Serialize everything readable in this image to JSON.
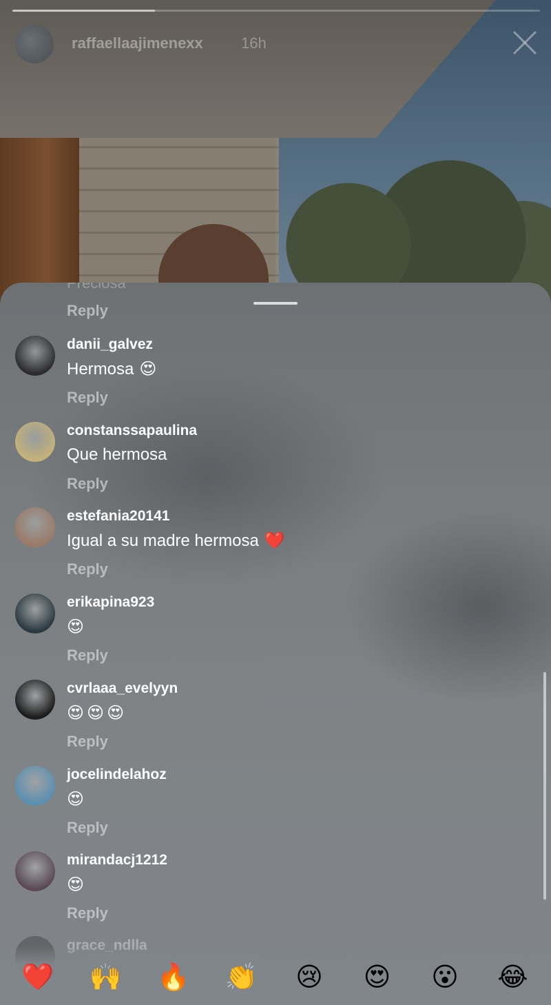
{
  "header": {
    "username": "raffaellaajimenexx",
    "time": "16h",
    "progress": 0.27,
    "close_icon": "close-icon"
  },
  "sheet": {
    "partial_comment": "Preciosa",
    "partial_reply": "Reply",
    "comments": [
      {
        "username": "danii_galvez",
        "text": "Hermosa",
        "emojis": [
          "heart-eyes"
        ],
        "reply": "Reply",
        "avatar_color": "#2c2c2e"
      },
      {
        "username": "constanssapaulina",
        "text": "Que hermosa",
        "emojis": [],
        "reply": "Reply",
        "avatar_color": "#c4b27a"
      },
      {
        "username": "estefania20141",
        "text": "Igual a su madre hermosa",
        "emojis": [
          "red-heart"
        ],
        "reply": "Reply",
        "avatar_color": "#9a7a68"
      },
      {
        "username": "erikapina923",
        "text": "",
        "emojis": [
          "heart-eyes"
        ],
        "reply": "Reply",
        "avatar_color": "#2a3a40"
      },
      {
        "username": "cvrlaaa_evelyyn",
        "text": "",
        "emojis": [
          "heart-eyes",
          "heart-eyes",
          "heart-eyes"
        ],
        "reply": "Reply",
        "avatar_color": "#1c1c1c"
      },
      {
        "username": "jocelindelahoz",
        "text": "",
        "emojis": [
          "heart-eyes"
        ],
        "reply": "Reply",
        "avatar_color": "#5b8fb0"
      },
      {
        "username": "mirandacj1212",
        "text": "",
        "emojis": [
          "heart-eyes"
        ],
        "reply": "Reply",
        "avatar_color": "#5a4a55"
      }
    ],
    "next_username_partial": "grace_ndlla"
  },
  "reactions": [
    {
      "name": "red-heart",
      "glyph": "❤️"
    },
    {
      "name": "raising-hands",
      "glyph": "🙌"
    },
    {
      "name": "fire",
      "glyph": "🔥"
    },
    {
      "name": "clapping-hands",
      "glyph": "👏"
    },
    {
      "name": "crying-face",
      "glyph": "😢"
    },
    {
      "name": "heart-eyes",
      "glyph": "😍"
    },
    {
      "name": "astonished-face",
      "glyph": "😮"
    },
    {
      "name": "tears-of-joy",
      "glyph": "😂"
    }
  ],
  "emoji_glyphs": {
    "heart-eyes": "😍",
    "red-heart": "❤️"
  }
}
